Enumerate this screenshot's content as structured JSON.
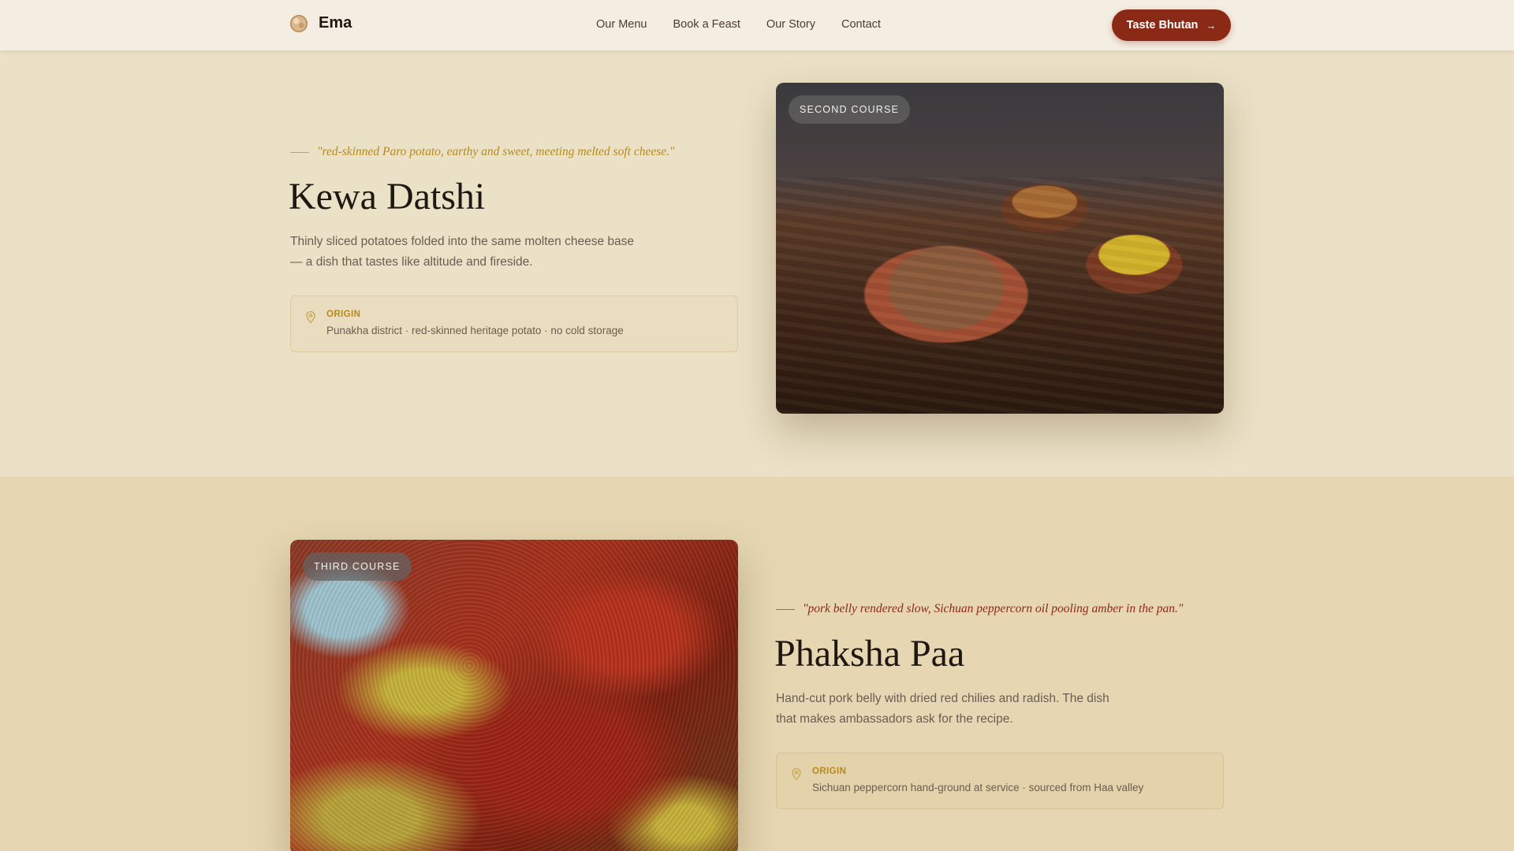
{
  "header": {
    "brand": "Ema",
    "nav": [
      "Our Menu",
      "Book a Feast",
      "Our Story",
      "Contact"
    ],
    "cta_label": "Taste Bhutan"
  },
  "dishes": [
    {
      "course": "SECOND COURSE",
      "quote": "\"red-skinned Paro potato, earthy and sweet, meeting melted soft cheese.\"",
      "title": "Kewa Datshi",
      "description": "Thinly sliced potatoes folded into the same molten cheese base — a dish that tastes like altitude and fireside.",
      "origin_label": "ORIGIN",
      "origin_value": "Punakha district · red-skinned heritage potato · no cold storage"
    },
    {
      "course": "THIRD COURSE",
      "quote": "\"pork belly rendered slow, Sichuan peppercorn oil pooling amber in the pan.\"",
      "title": "Phaksha Paa",
      "description": "Hand-cut pork belly with dried red chilies and radish. The dish that makes ambassadors ask for the recipe.",
      "origin_label": "ORIGIN",
      "origin_value": "Sichuan peppercorn hand-ground at service · sourced from Haa valley"
    }
  ],
  "icons": {
    "logo": "spice-disc-icon",
    "cta": "arrow-right-icon",
    "origin": "location-pin-icon"
  },
  "colors": {
    "accent": "#8a2a16",
    "gold": "#b68a1c",
    "header_bg": "#f4ede2",
    "section_1_bg": "#ebe1c6",
    "section_2_bg": "#e6d6b2"
  }
}
